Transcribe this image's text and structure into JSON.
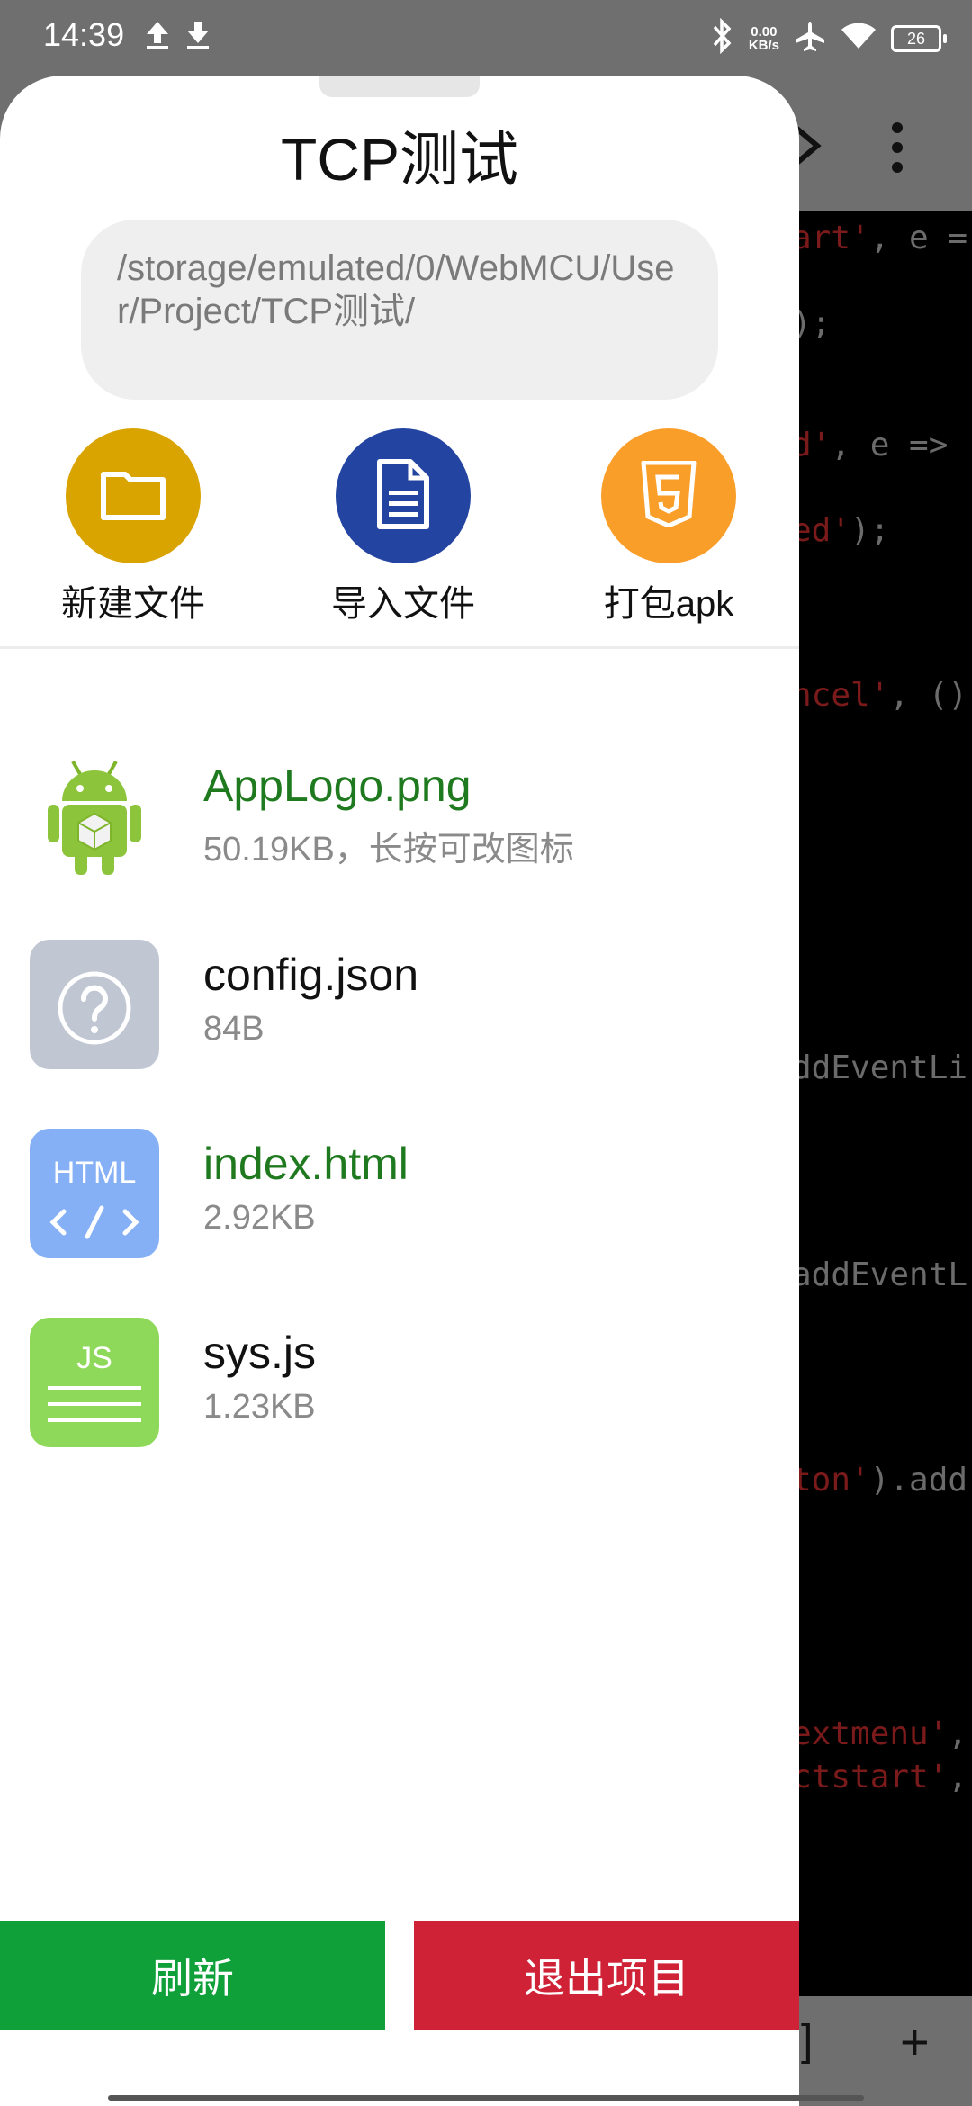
{
  "status_bar": {
    "time": "14:39",
    "net_speed_value": "0.00",
    "net_speed_unit": "KB/s",
    "battery": "26"
  },
  "drawer": {
    "title": "TCP测试",
    "path": "/storage/emulated/0/WebMCU/User/Project/TCP测试/",
    "actions": [
      {
        "label": "新建文件",
        "icon": "folder-icon",
        "color": "#D9A300"
      },
      {
        "label": "导入文件",
        "icon": "document-icon",
        "color": "#2344A0"
      },
      {
        "label": "打包apk",
        "icon": "html5-icon",
        "color": "#FA9E2A"
      }
    ],
    "files": [
      {
        "name": "AppLogo.png",
        "meta": "50.19KB，长按可改图标",
        "icon": "android-icon",
        "highlight": true
      },
      {
        "name": "config.json",
        "meta": "84B",
        "icon": "unknown-file-icon",
        "highlight": false
      },
      {
        "name": "index.html",
        "meta": "2.92KB",
        "icon": "html-file-icon",
        "highlight": true
      },
      {
        "name": "sys.js",
        "meta": "1.23KB",
        "icon": "js-file-icon",
        "highlight": false
      }
    ]
  },
  "buttons": {
    "refresh": "刷新",
    "exit": "退出项目"
  },
  "editor": {
    "code_lines": [
      {
        "pre": "",
        "str": "art'",
        "post": ", e ="
      },
      {
        "pre": ");",
        "str": "",
        "post": ""
      },
      {
        "pre": "",
        "str": "d'",
        "post": ", e =>"
      },
      {
        "pre": "",
        "str": "ed'",
        "post": ");"
      },
      {
        "pre": "",
        "str": "ncel'",
        "post": ", ()"
      },
      {
        "pre": "ddEventLi",
        "str": "",
        "post": ""
      },
      {
        "pre": "addEventL",
        "str": "",
        "post": ""
      },
      {
        "pre": "",
        "str": "ton'",
        "post": ").add"
      },
      {
        "pre": "",
        "str": "extmenu'",
        "post": ","
      },
      {
        "pre": "",
        "str": "ctstart'",
        "post": ","
      }
    ],
    "bottom_bracket": "]",
    "bottom_plus": "+"
  },
  "colors": {
    "refresh_button": "#10A03A",
    "exit_button": "#CF2236",
    "highlight_filename": "#1F7A1F"
  }
}
